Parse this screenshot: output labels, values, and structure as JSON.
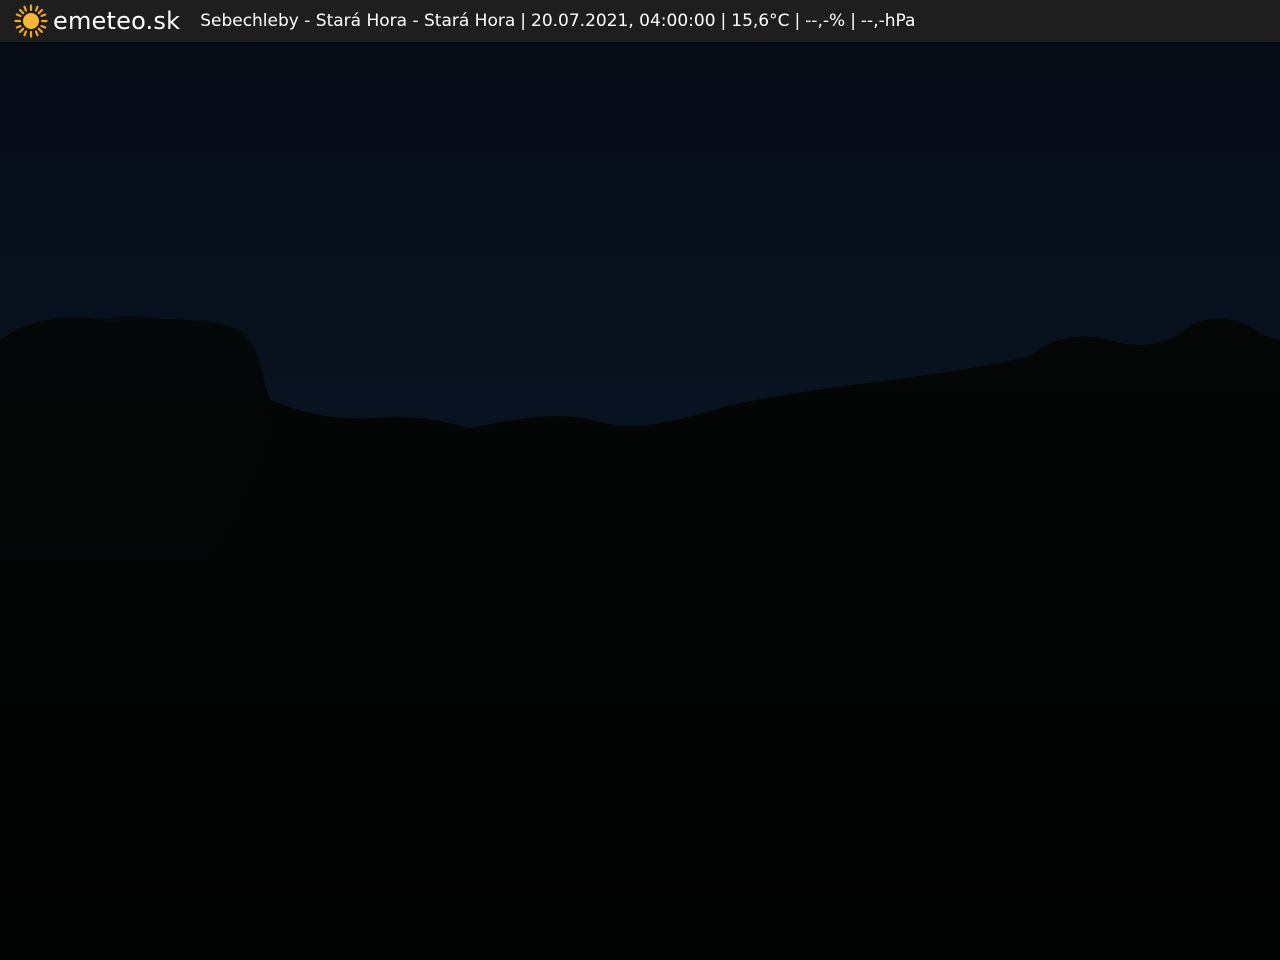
{
  "overlay": {
    "logo_icon": "sun-icon",
    "brand": "emeteo.sk",
    "location": "Sebechleby - Stará Hora - Stará Hora",
    "separator": "|",
    "datetime": "20.07.2021, 04:00:00",
    "temperature": "15,6°C",
    "humidity": "--,-%",
    "pressure": "--,-hPa"
  },
  "colors": {
    "bar_background": "#1e1e1e",
    "sun_accent": "#f5a623",
    "sky_top": "#050a14",
    "sky_horizon": "#0b1a2b",
    "ground": "#020303"
  }
}
